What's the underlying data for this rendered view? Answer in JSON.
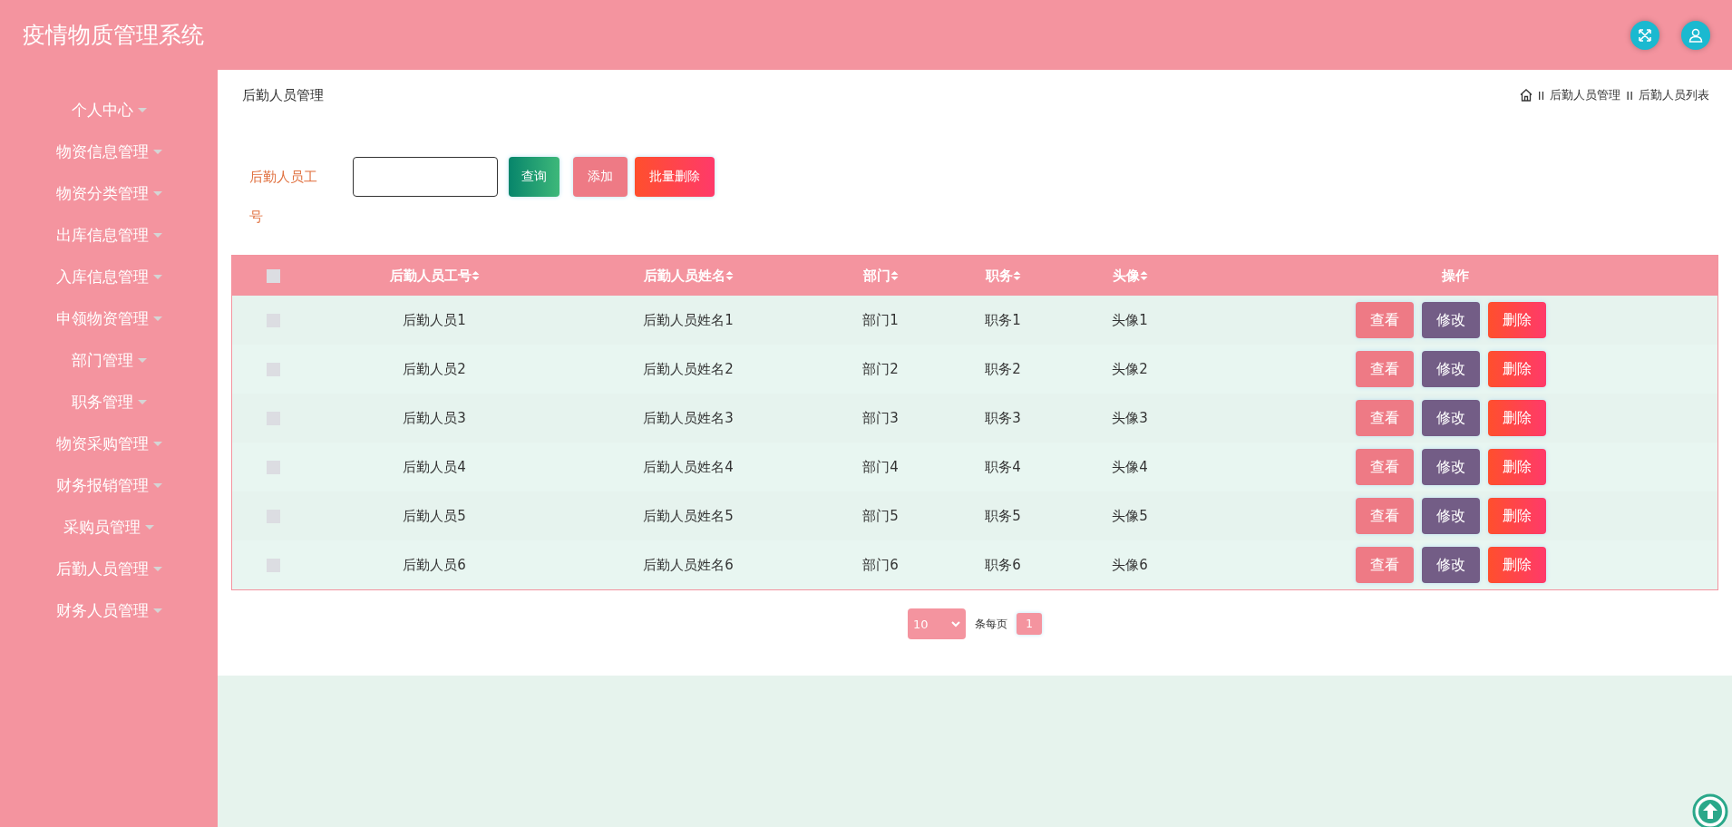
{
  "header": {
    "title": "疫情物质管理系统"
  },
  "sidebar": {
    "items": [
      {
        "label": "个人中心"
      },
      {
        "label": "物资信息管理"
      },
      {
        "label": "物资分类管理"
      },
      {
        "label": "出库信息管理"
      },
      {
        "label": "入库信息管理"
      },
      {
        "label": "申领物资管理"
      },
      {
        "label": "部门管理"
      },
      {
        "label": "职务管理"
      },
      {
        "label": "物资采购管理"
      },
      {
        "label": "财务报销管理"
      },
      {
        "label": "采购员管理"
      },
      {
        "label": "后勤人员管理"
      },
      {
        "label": "财务人员管理"
      }
    ]
  },
  "page_title": "后勤人员管理",
  "breadcrumb": [
    {
      "kind": "home"
    },
    {
      "kind": "sep",
      "label": "II"
    },
    {
      "kind": "text",
      "label": "后勤人员管理"
    },
    {
      "kind": "sep",
      "label": "II"
    },
    {
      "kind": "text",
      "label": "后勤人员列表"
    }
  ],
  "search": {
    "label": "后勤人员工号",
    "buttons": [
      {
        "kind": "query",
        "label": "查询"
      },
      {
        "kind": "add",
        "label": "添加"
      },
      {
        "kind": "delete",
        "label": "批量删除"
      }
    ]
  },
  "table": {
    "select_all": {
      "checked": false
    },
    "columns": [
      {
        "label": "后勤人员工号",
        "sortable": true
      },
      {
        "label": "后勤人员姓名",
        "sortable": true
      },
      {
        "label": "部门",
        "sortable": true
      },
      {
        "label": "职务",
        "sortable": true
      },
      {
        "label": "头像",
        "sortable": true
      },
      {
        "label": "操作",
        "sortable": false
      }
    ],
    "rows": [
      {
        "checked": false,
        "cells": [
          "后勤人员1",
          "后勤人员姓名1",
          "部门1",
          "职务1",
          "头像1"
        ],
        "actions": [
          {
            "kind": "view",
            "label": "查看"
          },
          {
            "kind": "edit",
            "label": "修改"
          },
          {
            "kind": "delete",
            "label": "删除"
          }
        ]
      },
      {
        "checked": false,
        "cells": [
          "后勤人员2",
          "后勤人员姓名2",
          "部门2",
          "职务2",
          "头像2"
        ],
        "actions": [
          {
            "kind": "view",
            "label": "查看"
          },
          {
            "kind": "edit",
            "label": "修改"
          },
          {
            "kind": "delete",
            "label": "删除"
          }
        ]
      },
      {
        "checked": false,
        "cells": [
          "后勤人员3",
          "后勤人员姓名3",
          "部门3",
          "职务3",
          "头像3"
        ],
        "actions": [
          {
            "kind": "view",
            "label": "查看"
          },
          {
            "kind": "edit",
            "label": "修改"
          },
          {
            "kind": "delete",
            "label": "删除"
          }
        ]
      },
      {
        "checked": false,
        "cells": [
          "后勤人员4",
          "后勤人员姓名4",
          "部门4",
          "职务4",
          "头像4"
        ],
        "actions": [
          {
            "kind": "view",
            "label": "查看"
          },
          {
            "kind": "edit",
            "label": "修改"
          },
          {
            "kind": "delete",
            "label": "删除"
          }
        ]
      },
      {
        "checked": false,
        "cells": [
          "后勤人员5",
          "后勤人员姓名5",
          "部门5",
          "职务5",
          "头像5"
        ],
        "actions": [
          {
            "kind": "view",
            "label": "查看"
          },
          {
            "kind": "edit",
            "label": "修改"
          },
          {
            "kind": "delete",
            "label": "删除"
          }
        ]
      },
      {
        "checked": false,
        "cells": [
          "后勤人员6",
          "后勤人员姓名6",
          "部门6",
          "职务6",
          "头像6"
        ],
        "actions": [
          {
            "kind": "view",
            "label": "查看"
          },
          {
            "kind": "edit",
            "label": "修改"
          },
          {
            "kind": "delete",
            "label": "删除"
          }
        ]
      }
    ]
  },
  "pagination": {
    "page_size": "10",
    "page_size_label": "条每页",
    "pages": [
      {
        "label": "1",
        "selected": true
      }
    ]
  }
}
